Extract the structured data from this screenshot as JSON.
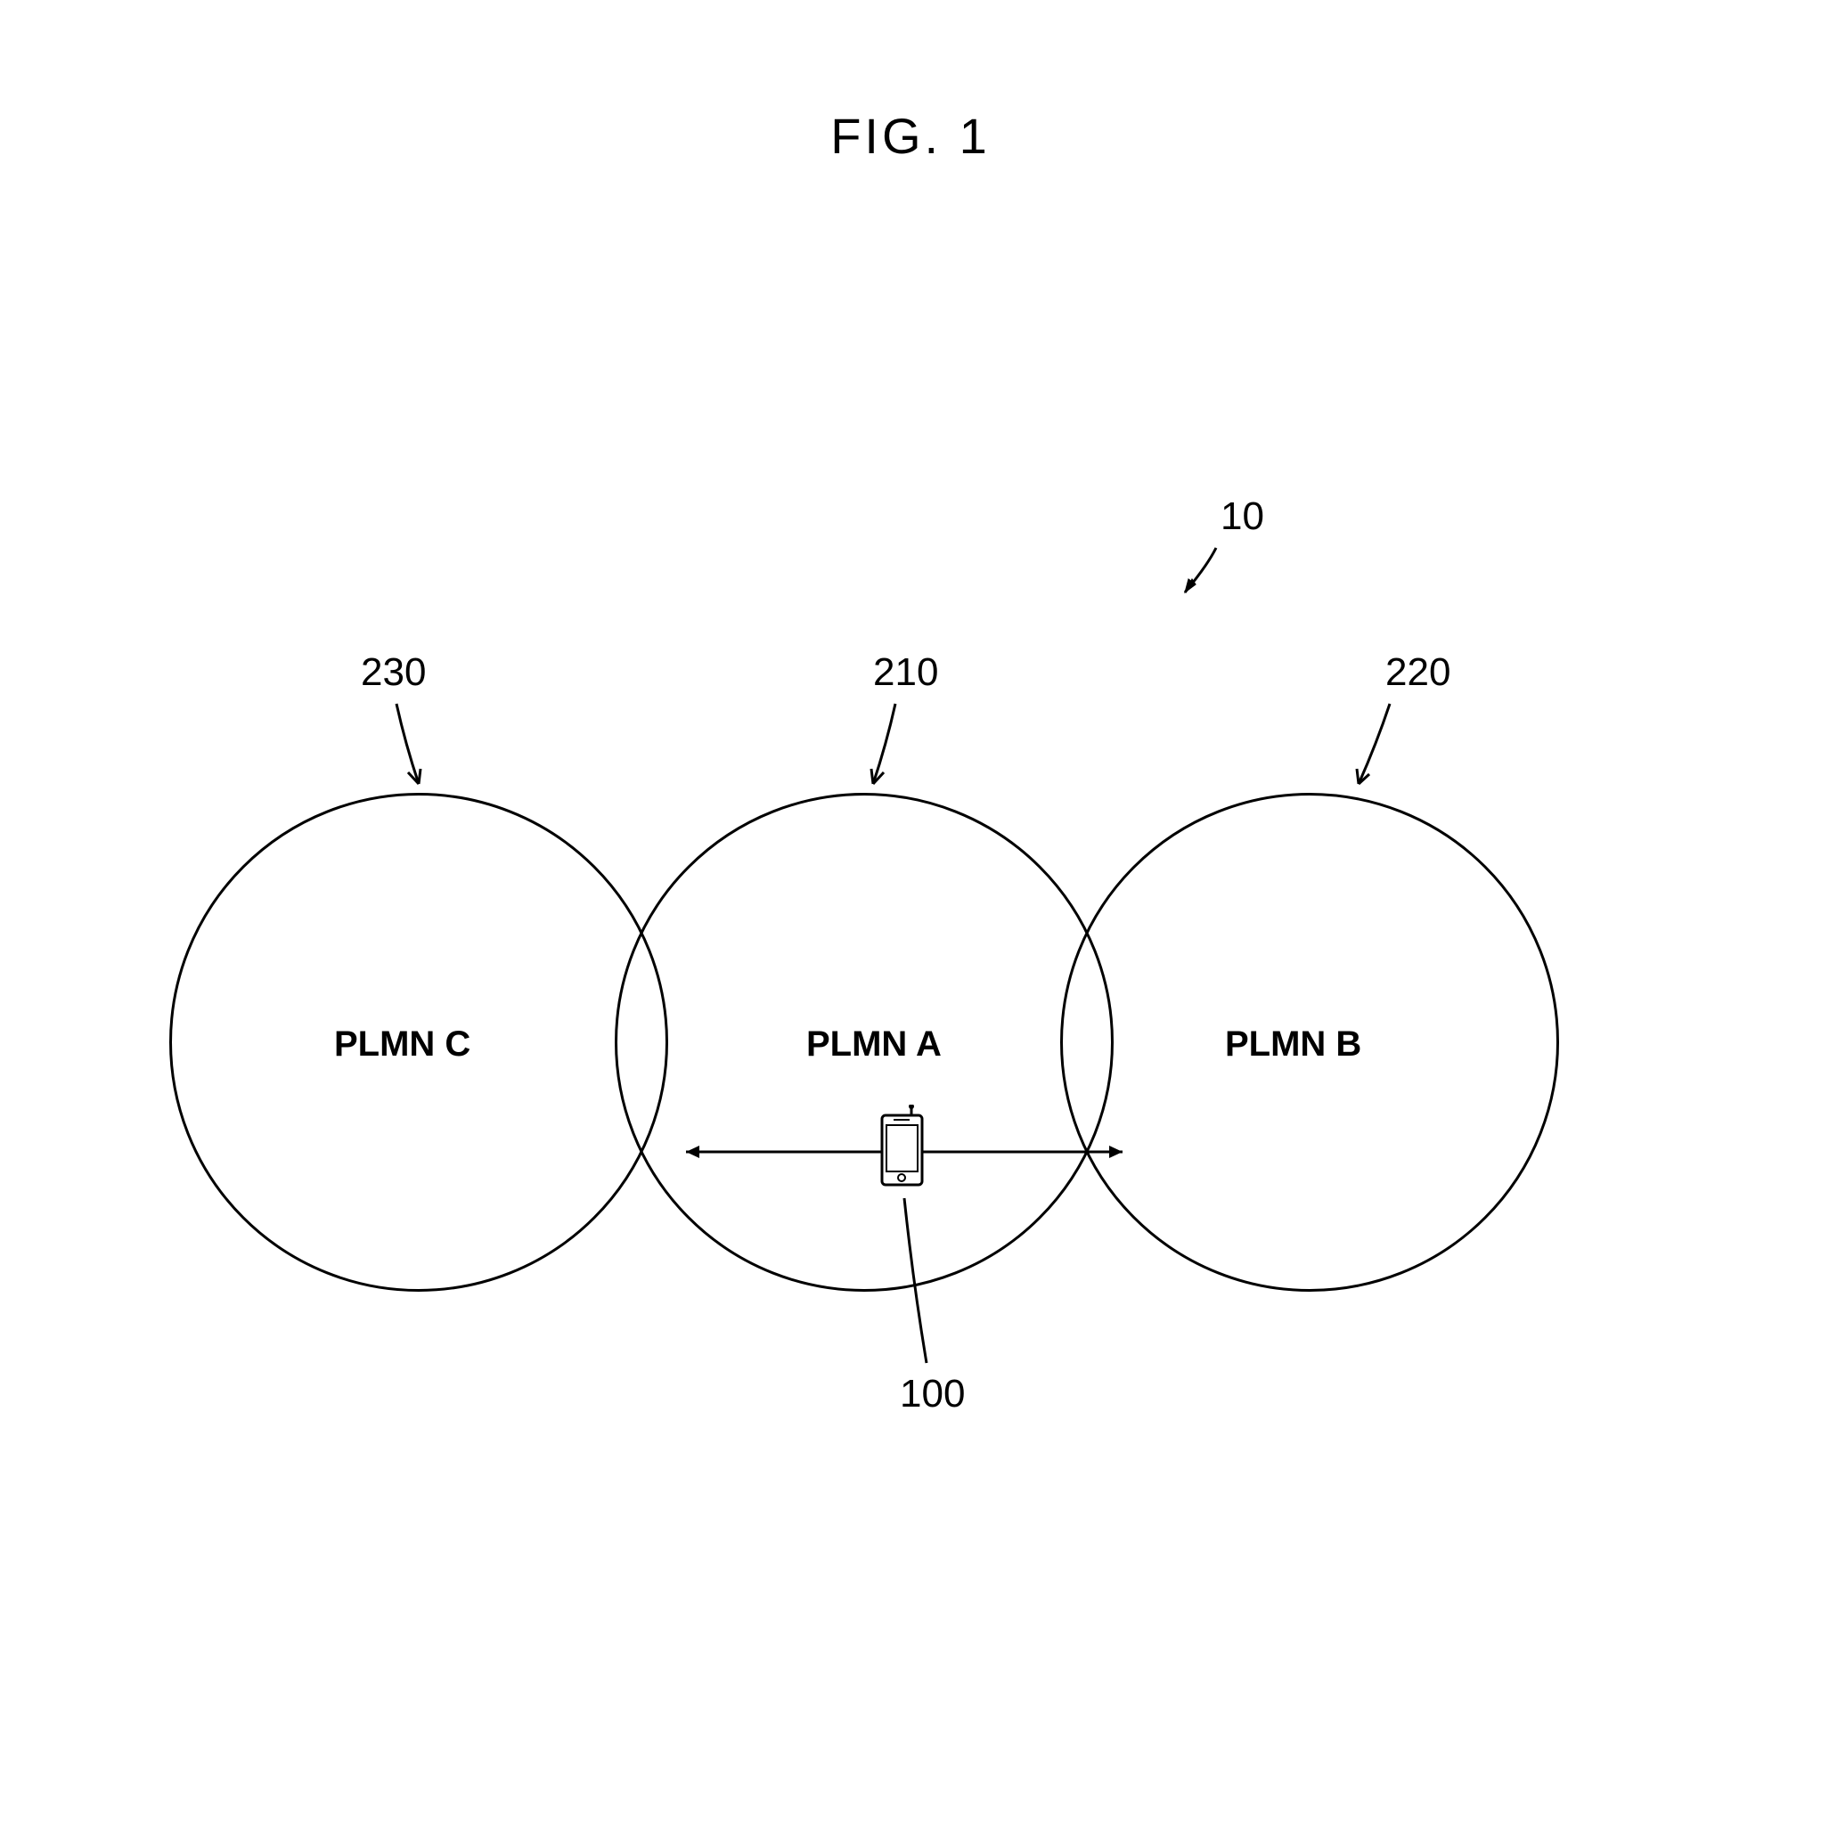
{
  "title": "FIG. 1",
  "system_ref": "10",
  "circles": {
    "c": {
      "label": "PLMN C",
      "ref": "230"
    },
    "a": {
      "label": "PLMN A",
      "ref": "210"
    },
    "b": {
      "label": "PLMN B",
      "ref": "220"
    }
  },
  "device_ref": "100"
}
